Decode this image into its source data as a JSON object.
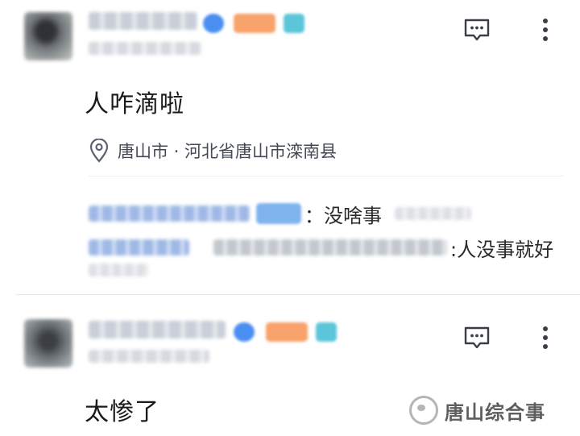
{
  "posts": [
    {
      "text": "人咋滴啦",
      "location": "唐山市 · 河北省唐山市滦南县",
      "comments": [
        {
          "text": "：没啥事"
        },
        {
          "text": ":人没事就好"
        }
      ]
    },
    {
      "text": "太惨了"
    }
  ],
  "watermark": {
    "text": "唐山综合事"
  },
  "icons": {
    "comment": "comment-icon",
    "more": "more-vertical-icon",
    "location": "location-pin-icon"
  },
  "colors": {
    "badge_blue": "#4a8ef0",
    "badge_orange": "#f7a36b",
    "badge_teal": "#5bc6d9",
    "icon_grey": "#3a3f47"
  }
}
